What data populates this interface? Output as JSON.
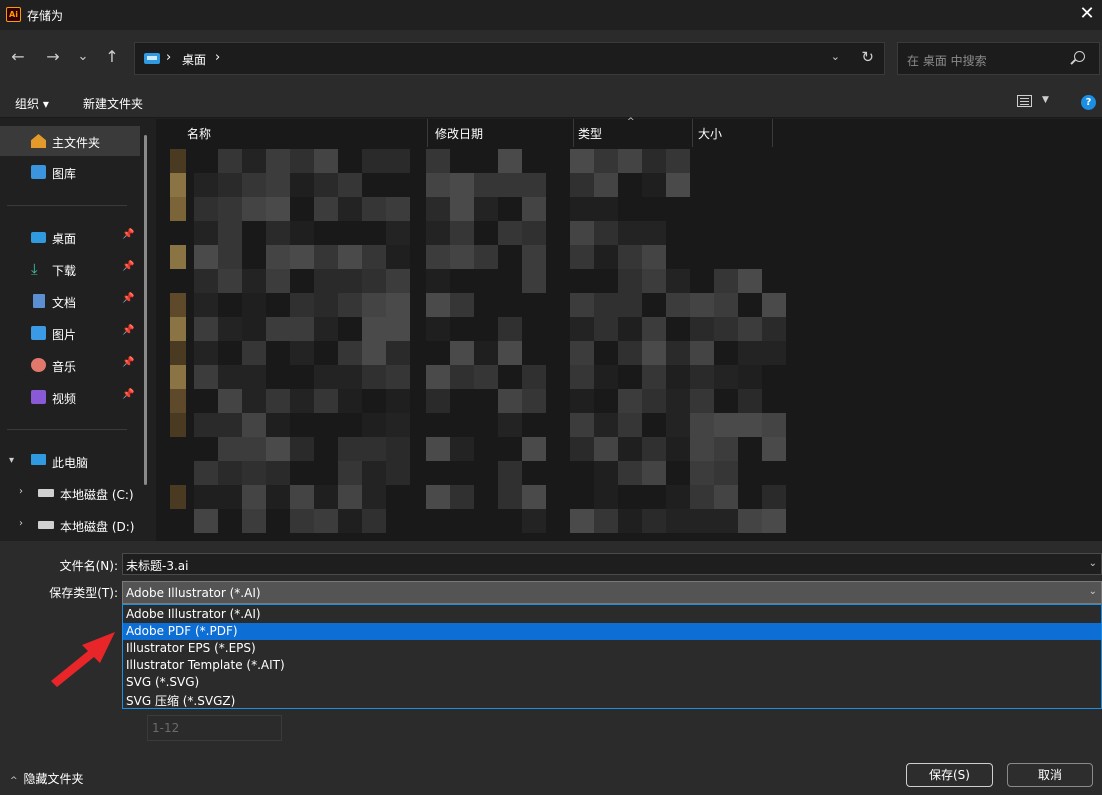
{
  "window": {
    "app_icon": "Ai",
    "title": "存储为",
    "close": "✕"
  },
  "nav": {
    "back": "←",
    "forward": "→",
    "recent": "⌄",
    "up": "↑",
    "path": [
      "桌面"
    ],
    "search_placeholder": "在 桌面 中搜索"
  },
  "toolbar": {
    "organize": "组织 ▾",
    "new_folder": "新建文件夹",
    "help": "?"
  },
  "sidebar": {
    "items": [
      {
        "label": "主文件夹",
        "icon": "home-icon",
        "active": true
      },
      {
        "label": "图库",
        "icon": "gallery-icon"
      },
      {
        "label": "桌面",
        "icon": "desktop-icon",
        "pinned": true
      },
      {
        "label": "下载",
        "icon": "download-icon",
        "pinned": true
      },
      {
        "label": "文档",
        "icon": "documents-icon",
        "pinned": true
      },
      {
        "label": "图片",
        "icon": "pictures-icon",
        "pinned": true
      },
      {
        "label": "音乐",
        "icon": "music-icon",
        "pinned": true
      },
      {
        "label": "视频",
        "icon": "videos-icon",
        "pinned": true
      },
      {
        "label": "此电脑",
        "icon": "computer-icon",
        "expanded": true
      },
      {
        "label": "本地磁盘 (C:)",
        "icon": "drive-icon"
      },
      {
        "label": "本地磁盘 (D:)",
        "icon": "drive-icon"
      }
    ]
  },
  "filelist": {
    "columns": [
      "名称",
      "修改日期",
      "类型",
      "大小"
    ]
  },
  "save": {
    "filename_label": "文件名(N):",
    "filename_value": "未标题-3.ai",
    "type_label": "保存类型(T):",
    "type_value": "Adobe Illustrator (*.AI)",
    "type_options": [
      "Adobe Illustrator (*.AI)",
      "Adobe PDF (*.PDF)",
      "Illustrator EPS (*.EPS)",
      "Illustrator Template (*.AIT)",
      "SVG (*.SVG)",
      "SVG 压缩 (*.SVGZ)"
    ],
    "selected_option_index": 1,
    "range_value": "1-12",
    "hide_folders": "隐藏文件夹",
    "save_button": "保存(S)",
    "cancel_button": "取消"
  },
  "colors": {
    "accent": "#0d6ed6",
    "annotation_arrow": "#e8262a"
  }
}
